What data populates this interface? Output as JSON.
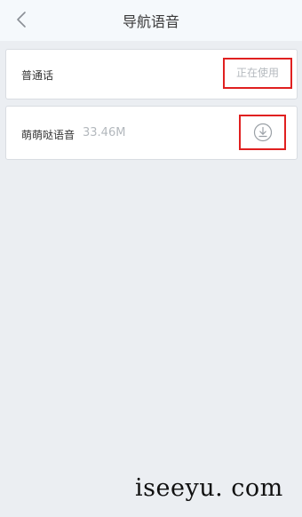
{
  "header": {
    "title": "导航语音"
  },
  "voices": [
    {
      "name": "普通话",
      "status": "正在使用"
    },
    {
      "name": "萌萌哒语音",
      "size": "33.46M"
    }
  ],
  "watermark": "iseeyu. com"
}
